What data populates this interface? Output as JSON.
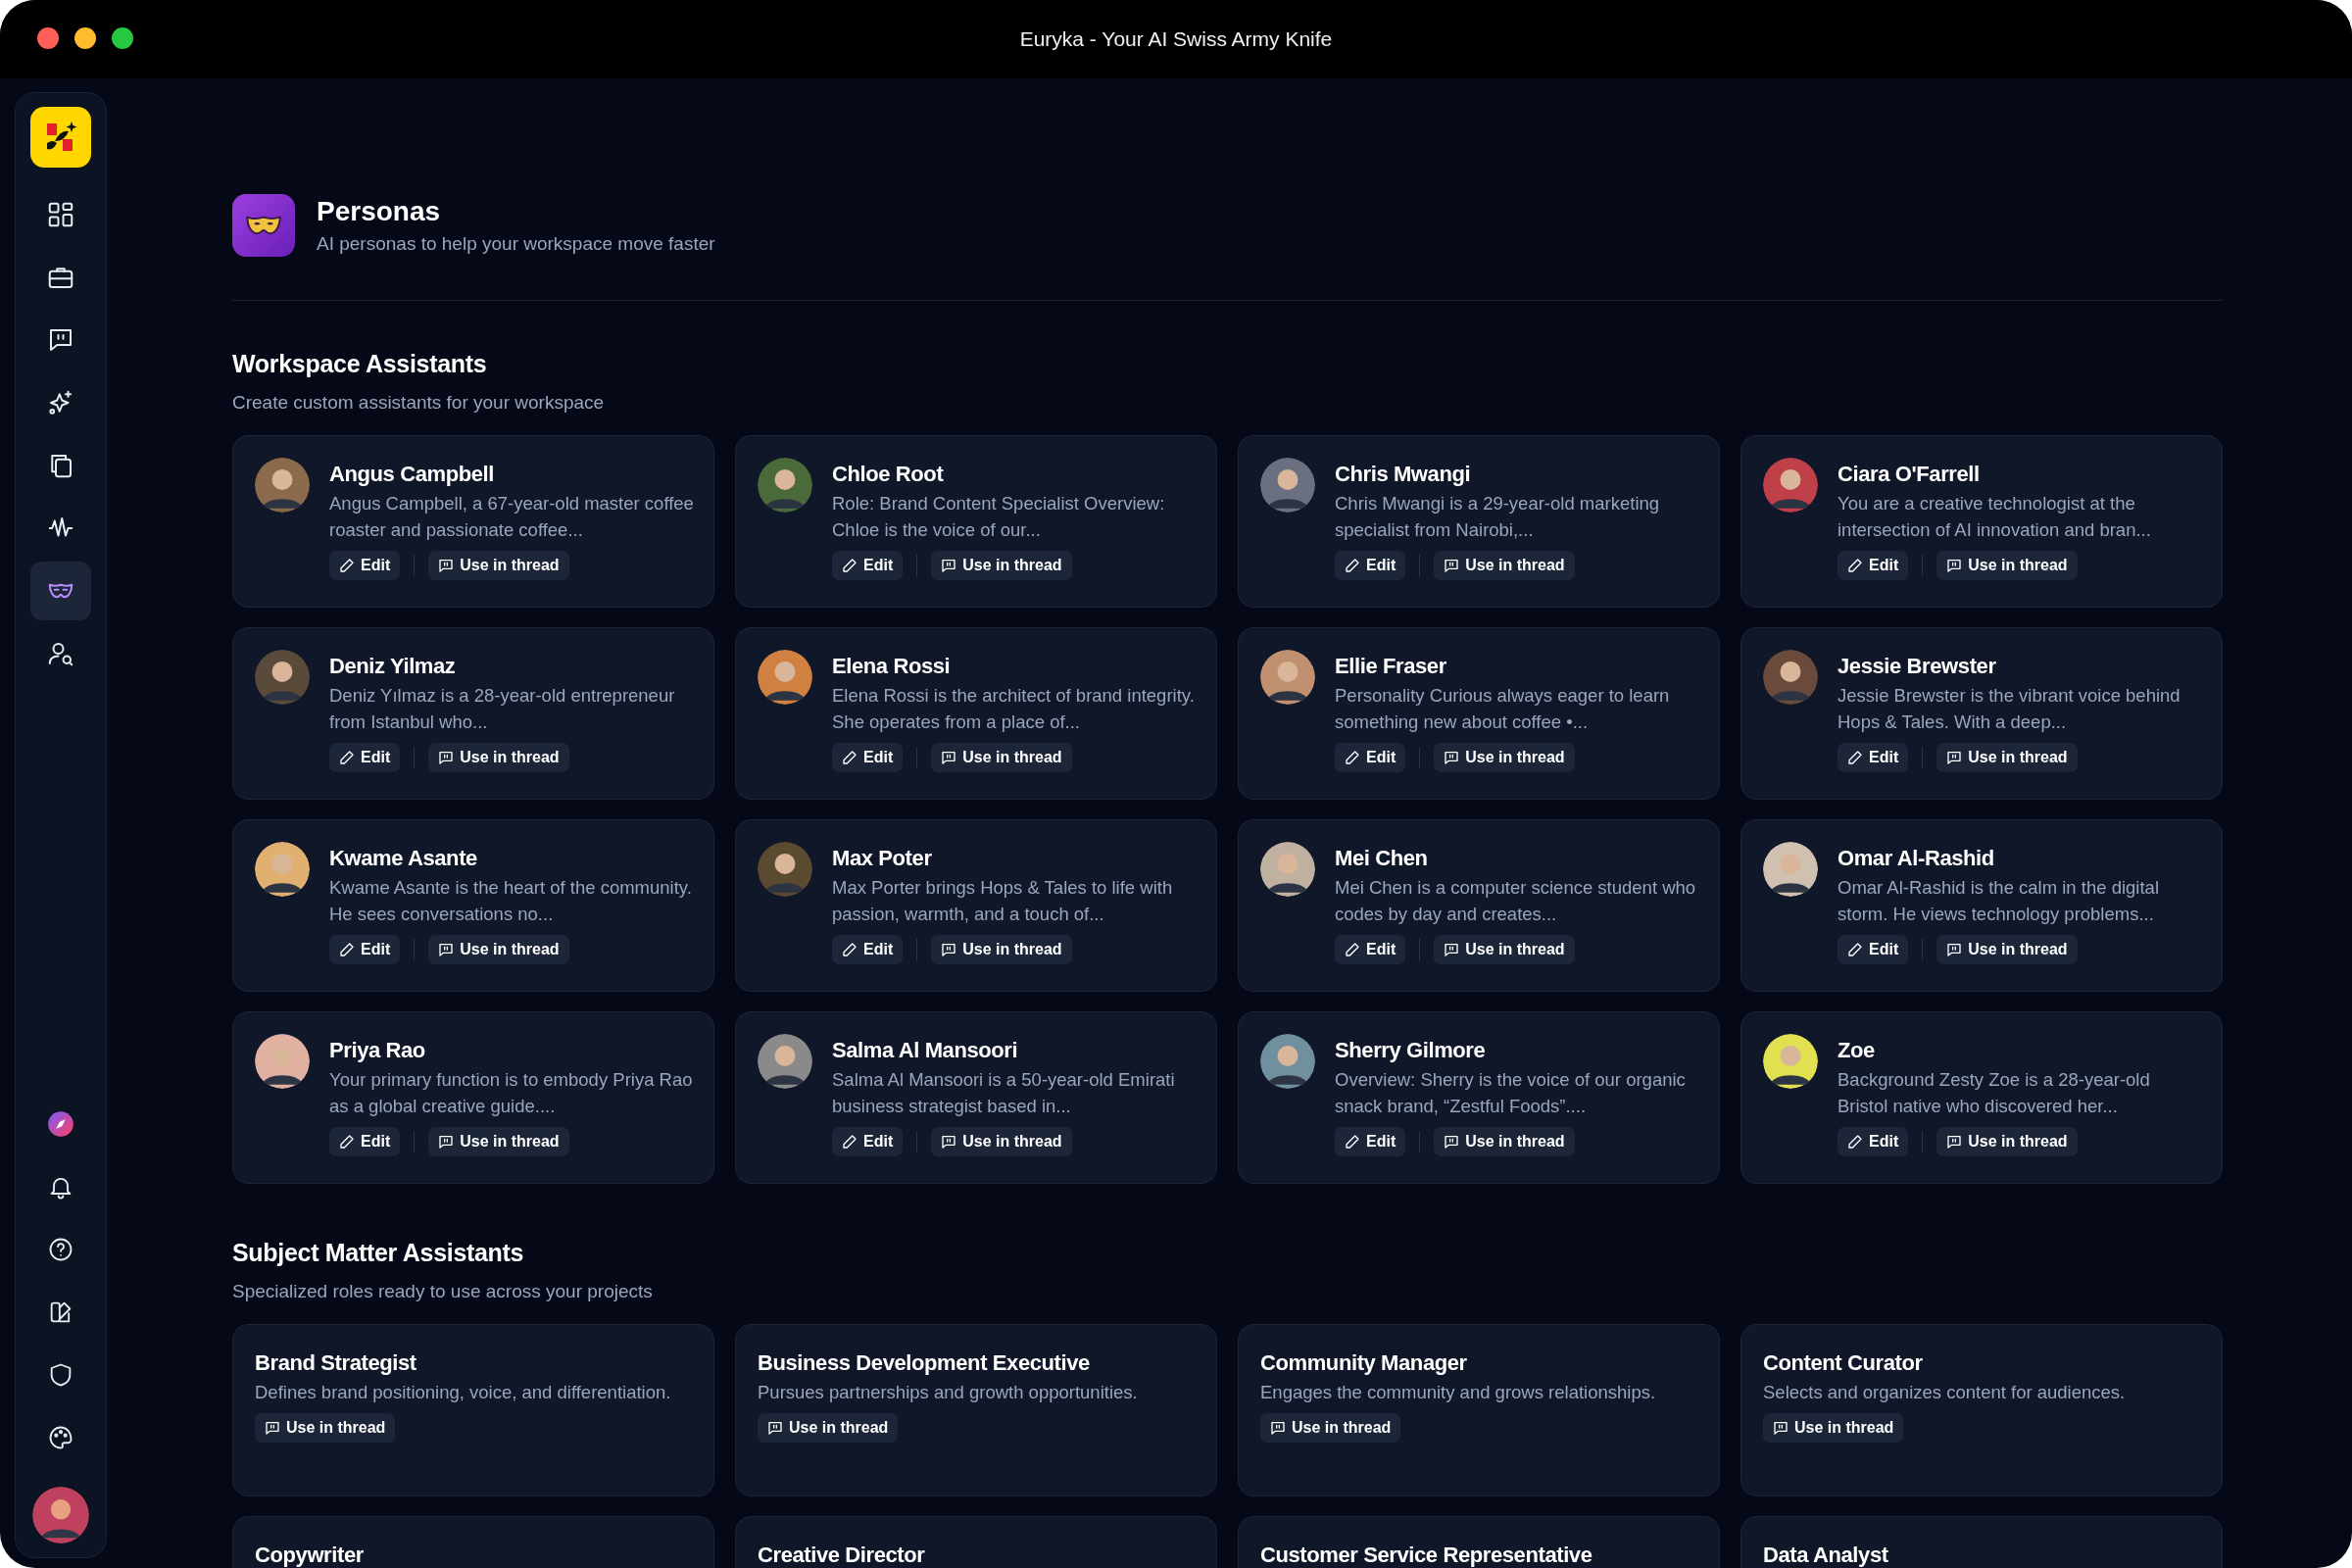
{
  "window": {
    "title": "Euryka - Your AI Swiss Army Knife"
  },
  "sidebar": {
    "top_items": [
      {
        "selected": false
      },
      {
        "selected": false
      },
      {
        "selected": false
      },
      {
        "selected": false
      },
      {
        "selected": false
      },
      {
        "selected": false
      },
      {
        "selected": true
      },
      {
        "selected": false
      }
    ],
    "bottom_items": [
      {
        "selected": false
      },
      {
        "selected": false
      },
      {
        "selected": false
      },
      {
        "selected": false
      },
      {
        "selected": false
      },
      {
        "selected": false
      }
    ]
  },
  "header": {
    "title": "Personas",
    "subtitle": "AI personas to help your workspace move faster"
  },
  "workspace_assistants": {
    "title": "Workspace Assistants",
    "subtitle": "Create custom assistants for your workspace",
    "cards": [
      {
        "name": "Angus Campbell",
        "description": "Angus Campbell, a 67-year-old master coffee roaster and passionate coffee...",
        "edit": "Edit",
        "use": "Use in thread"
      },
      {
        "name": "Chloe Root",
        "description": "Role: Brand Content Specialist Overview: Chloe is the voice of our...",
        "edit": "Edit",
        "use": "Use in thread"
      },
      {
        "name": "Chris Mwangi",
        "description": "Chris Mwangi is a 29-year-old marketing specialist from Nairobi,...",
        "edit": "Edit",
        "use": "Use in thread"
      },
      {
        "name": "Ciara O'Farrell",
        "description": "You are a creative technologist at the intersection of AI innovation and bran...",
        "edit": "Edit",
        "use": "Use in thread"
      },
      {
        "name": "Deniz Yilmaz",
        "description": "Deniz Yılmaz is a 28-year-old entrepreneur from Istanbul who...",
        "edit": "Edit",
        "use": "Use in thread"
      },
      {
        "name": "Elena Rossi",
        "description": "Elena Rossi is the architect of brand integrity. She operates from a place of...",
        "edit": "Edit",
        "use": "Use in thread"
      },
      {
        "name": "Ellie Fraser",
        "description": "Personality Curious always eager to learn something new about coffee •...",
        "edit": "Edit",
        "use": "Use in thread"
      },
      {
        "name": "Jessie Brewster",
        "description": "Jessie Brewster is the vibrant voice behind Hops & Tales. With a deep...",
        "edit": "Edit",
        "use": "Use in thread"
      },
      {
        "name": "Kwame Asante",
        "description": "Kwame Asante is the heart of the community. He sees conversations no...",
        "edit": "Edit",
        "use": "Use in thread"
      },
      {
        "name": "Max Poter",
        "description": "Max Porter brings Hops & Tales to life with passion, warmth, and a touch of...",
        "edit": "Edit",
        "use": "Use in thread"
      },
      {
        "name": "Mei Chen",
        "description": "Mei Chen is a computer science student who codes by day and creates...",
        "edit": "Edit",
        "use": "Use in thread"
      },
      {
        "name": "Omar Al-Rashid",
        "description": "Omar Al-Rashid is the calm in the digital storm. He views technology problems...",
        "edit": "Edit",
        "use": "Use in thread"
      },
      {
        "name": "Priya Rao",
        "description": "Your primary function is to embody Priya Rao as a global creative guide....",
        "edit": "Edit",
        "use": "Use in thread"
      },
      {
        "name": "Salma Al Mansoori",
        "description": "Salma Al Mansoori is a 50-year-old Emirati business strategist based in...",
        "edit": "Edit",
        "use": "Use in thread"
      },
      {
        "name": "Sherry Gilmore",
        "description": "Overview: Sherry is the voice of our organic snack brand, “Zestful Foods”....",
        "edit": "Edit",
        "use": "Use in thread"
      },
      {
        "name": "Zoe",
        "description": "Background Zesty Zoe is a 28-year-old Bristol native who discovered her...",
        "edit": "Edit",
        "use": "Use in thread"
      }
    ]
  },
  "subject_matter_assistants": {
    "title": "Subject Matter Assistants",
    "subtitle": "Specialized roles ready to use across your projects",
    "cards": [
      {
        "name": "Brand Strategist",
        "description": "Defines brand positioning, voice, and differentiation.",
        "use": "Use in thread"
      },
      {
        "name": "Business Development Executive",
        "description": "Pursues partnerships and growth opportunities.",
        "use": "Use in thread"
      },
      {
        "name": "Community Manager",
        "description": "Engages the community and grows relationships.",
        "use": "Use in thread"
      },
      {
        "name": "Content Curator",
        "description": "Selects and organizes content for audiences.",
        "use": "Use in thread"
      },
      {
        "name": "Copywriter"
      },
      {
        "name": "Creative Director"
      },
      {
        "name": "Customer Service Representative"
      },
      {
        "name": "Data Analyst"
      }
    ]
  }
}
